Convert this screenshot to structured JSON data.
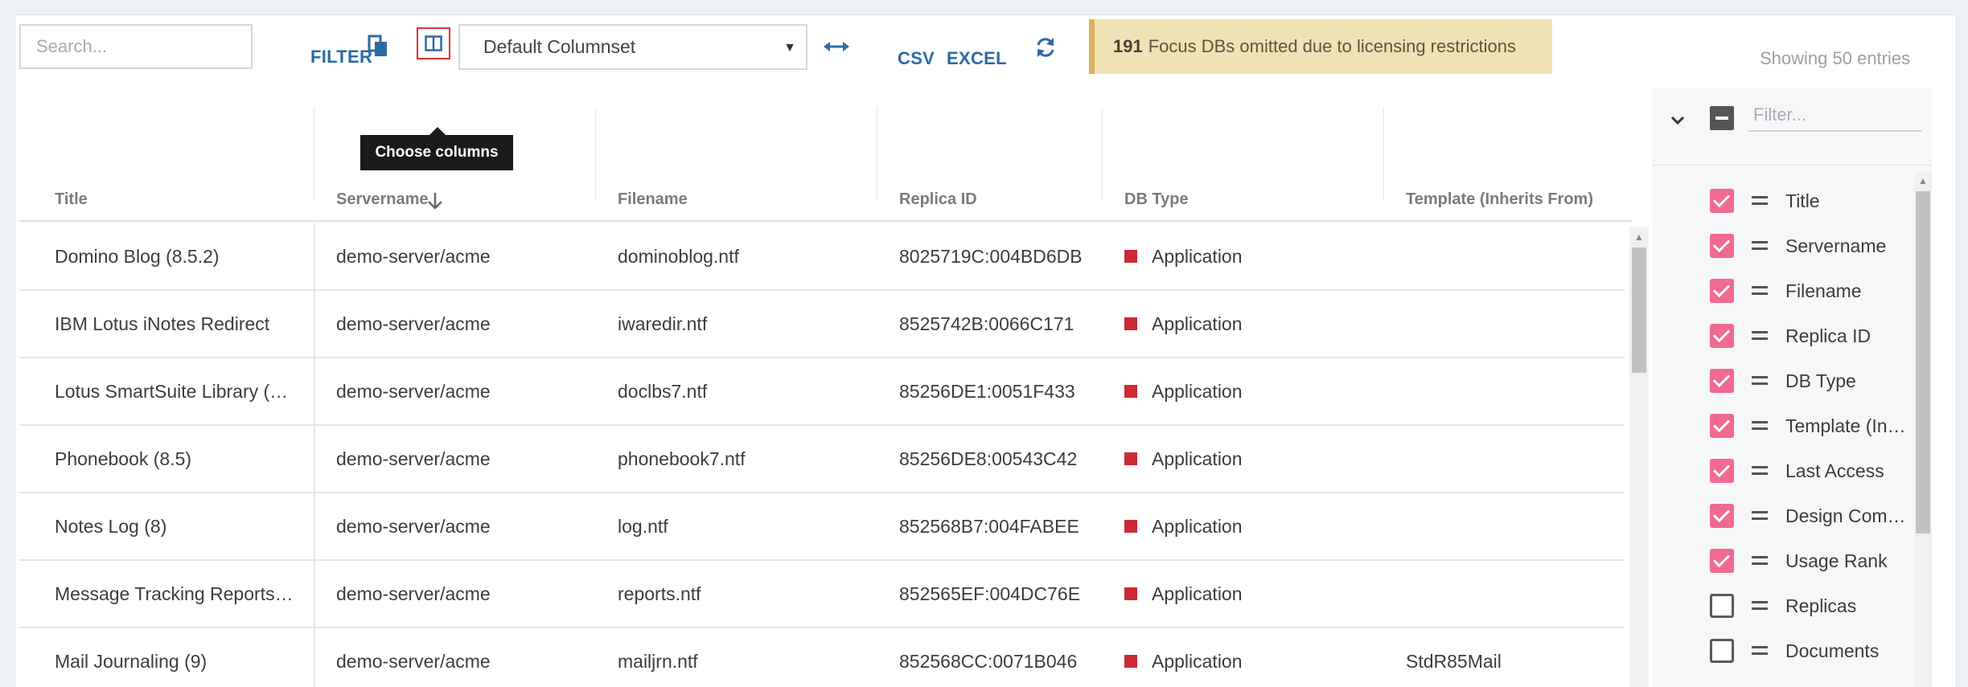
{
  "toolbar": {
    "search_placeholder": "Search...",
    "filter_label": "FILTER",
    "columnset_value": "Default Columnset",
    "csv_label": "CSV",
    "excel_label": "EXCEL",
    "notice_count": "191",
    "notice_text": "Focus DBs omitted due to licensing restrictions",
    "showing": "Showing 50 entries"
  },
  "tooltip": "Choose columns",
  "table": {
    "headers": [
      "Title",
      "Servername",
      "Filename",
      "Replica ID",
      "DB Type",
      "Template (Inherits From)"
    ],
    "sorted_column": "Servername",
    "rows": [
      {
        "title": "Domino Blog (8.5.2)",
        "server": "demo-server/acme",
        "file": "dominoblog.ntf",
        "replica": "8025719C:004BD6DB",
        "type": "Application",
        "template": ""
      },
      {
        "title": "IBM Lotus iNotes Redirect",
        "server": "demo-server/acme",
        "file": "iwaredir.ntf",
        "replica": "8525742B:0066C171",
        "type": "Application",
        "template": ""
      },
      {
        "title": "Lotus SmartSuite Library (…",
        "server": "demo-server/acme",
        "file": "doclbs7.ntf",
        "replica": "85256DE1:0051F433",
        "type": "Application",
        "template": ""
      },
      {
        "title": "Phonebook (8.5)",
        "server": "demo-server/acme",
        "file": "phonebook7.ntf",
        "replica": "85256DE8:00543C42",
        "type": "Application",
        "template": ""
      },
      {
        "title": "Notes Log (8)",
        "server": "demo-server/acme",
        "file": "log.ntf",
        "replica": "852568B7:004FABEE",
        "type": "Application",
        "template": ""
      },
      {
        "title": "Message Tracking Reports…",
        "server": "demo-server/acme",
        "file": "reports.ntf",
        "replica": "852565EF:004DC76E",
        "type": "Application",
        "template": ""
      },
      {
        "title": "Mail Journaling (9)",
        "server": "demo-server/acme",
        "file": "mailjrn.ntf",
        "replica": "852568CC:0071B046",
        "type": "Application",
        "template": "StdR85Mail"
      }
    ]
  },
  "columns_panel": {
    "filter_placeholder": "Filter...",
    "items": [
      {
        "label": "Title",
        "checked": true
      },
      {
        "label": "Servername",
        "checked": true
      },
      {
        "label": "Filename",
        "checked": true
      },
      {
        "label": "Replica ID",
        "checked": true
      },
      {
        "label": "DB Type",
        "checked": true
      },
      {
        "label": "Template (Inh…",
        "checked": true
      },
      {
        "label": "Last Access",
        "checked": true
      },
      {
        "label": "Design Comp…",
        "checked": true
      },
      {
        "label": "Usage Rank",
        "checked": true
      },
      {
        "label": "Replicas",
        "checked": false
      },
      {
        "label": "Documents",
        "checked": false
      }
    ]
  },
  "colors": {
    "accent_link": "#2c6aa5",
    "checkbox_on": "#f06a92",
    "db_type_marker": "#cc2a35",
    "notice_bg": "#f0e2b4"
  }
}
